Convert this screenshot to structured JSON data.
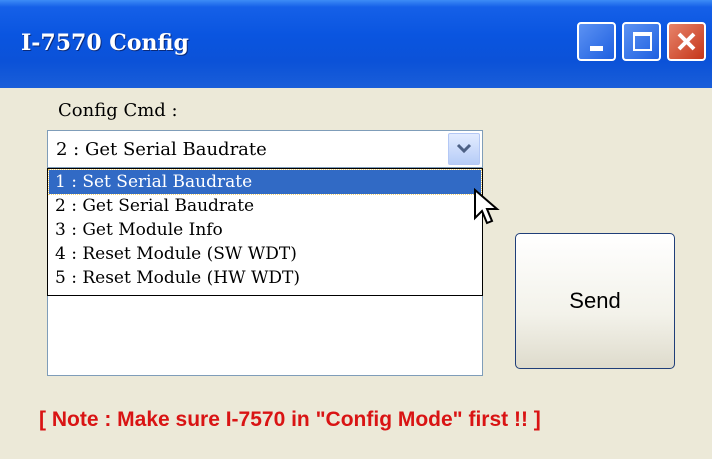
{
  "window": {
    "title": "I-7570 Config",
    "buttons": [
      "minimize-icon",
      "maximize-icon",
      "close-icon"
    ]
  },
  "config_cmd": {
    "label": "Config Cmd :",
    "selected_value": "2 : Get Serial Baudrate",
    "options": [
      "1 : Set Serial Baudrate",
      "2 : Get Serial Baudrate",
      "3 : Get Module Info",
      "4 : Reset Module (SW WDT)",
      "5 : Reset Module (HW WDT)"
    ],
    "highlighted_option": "1 : Set Serial Baudrate"
  },
  "send_button": {
    "label": "Send"
  },
  "note": "[ Note : Make sure I-7570 in \"Config Mode\" first !! ]",
  "colors": {
    "title_bar": "#0a55e0",
    "client_bg": "#ece9d8",
    "selection": "#316ac5",
    "note_text": "#d91414"
  }
}
